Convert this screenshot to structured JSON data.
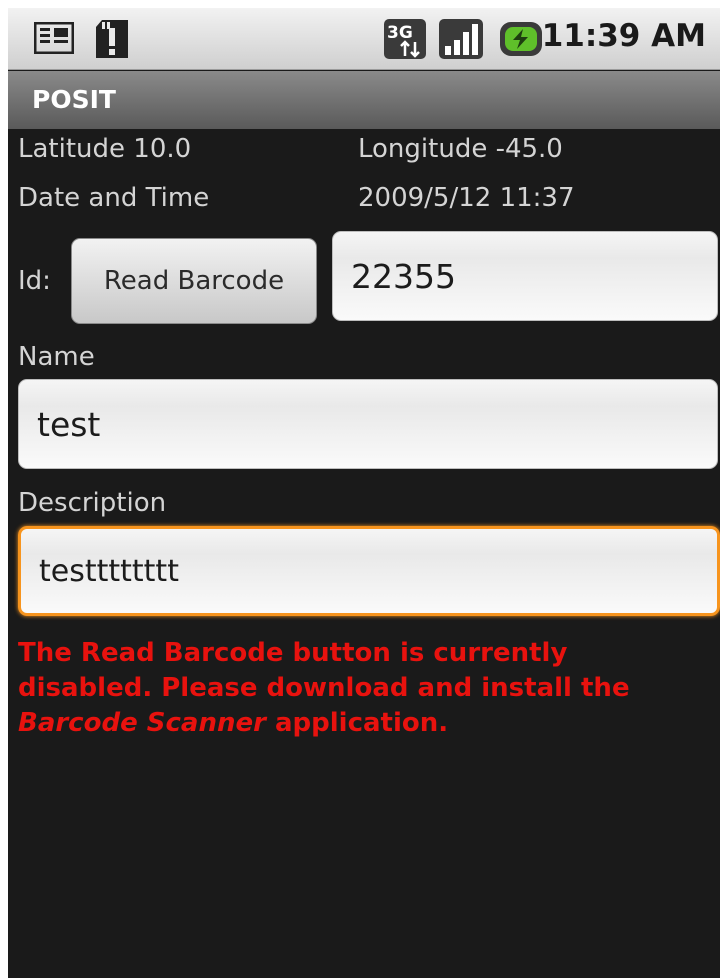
{
  "status_bar": {
    "time": "11:39 AM",
    "network_type": "3G",
    "icons": [
      "news-icon",
      "sd-card-alert-icon",
      "3g-data-icon",
      "signal-strength-icon",
      "battery-charging-icon"
    ]
  },
  "app": {
    "title": "POSIT"
  },
  "location": {
    "latitude_label": "Latitude 10.0",
    "longitude_label": "Longitude  -45.0"
  },
  "datetime": {
    "label": "Date and Time",
    "value": "2009/5/12 11:37"
  },
  "id_row": {
    "label": "Id:",
    "button_label": "Read Barcode",
    "value": "22355"
  },
  "name": {
    "label": "Name",
    "value": "test"
  },
  "description": {
    "label": "Description",
    "value": "testttttttt"
  },
  "warning": {
    "part1": "The Read Barcode button is currently disabled. Please download and install the ",
    "app_name": "Barcode Scanner",
    "part2": " application."
  },
  "colors": {
    "background": "#1a1a1a",
    "warning": "#e8120e",
    "focus": "#f7941d",
    "label": "#d4d4d4"
  }
}
